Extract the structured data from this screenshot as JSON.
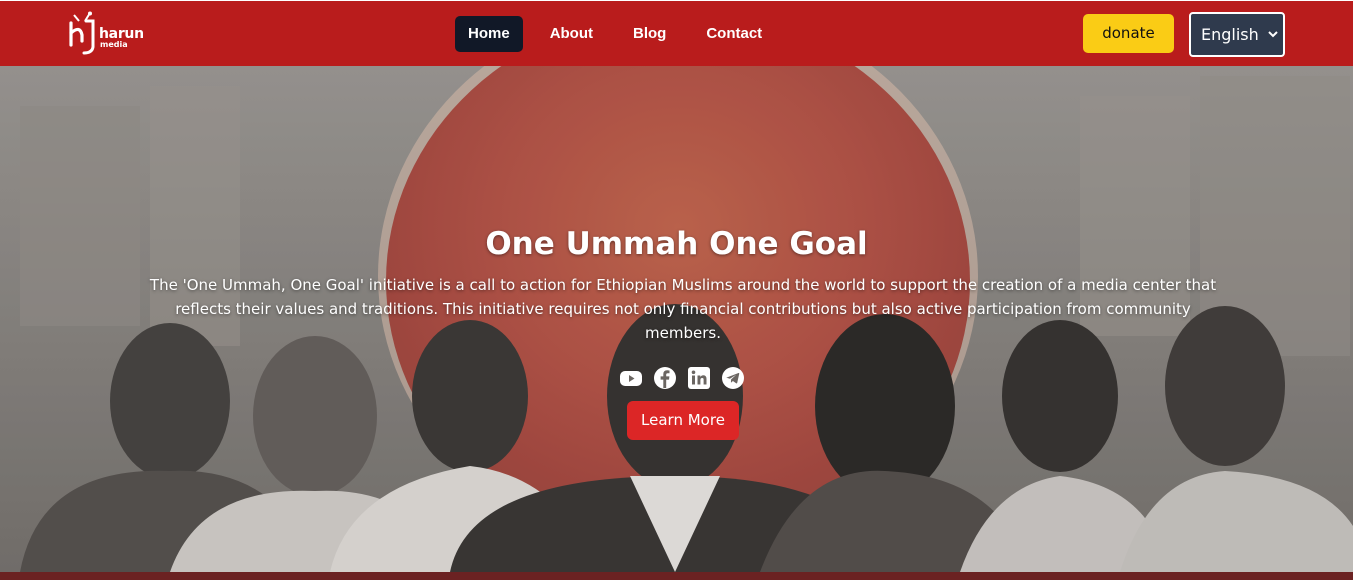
{
  "brand": {
    "name": "harun",
    "sub": "media",
    "colors": {
      "nav": "#b91c1c",
      "donate": "#facc15",
      "cta": "#dc2626",
      "active": "#111827"
    }
  },
  "nav": {
    "items": [
      {
        "label": "Home",
        "active": true
      },
      {
        "label": "About",
        "active": false
      },
      {
        "label": "Blog",
        "active": false
      },
      {
        "label": "Contact",
        "active": false
      }
    ],
    "donate_label": "donate",
    "language": {
      "selected": "English"
    }
  },
  "hero": {
    "title": "One Ummah One Goal",
    "description": "The 'One Ummah, One Goal' initiative is a call to action for Ethiopian Muslims around the world to support the creation of a media center that reflects their values and traditions. This initiative requires not only financial contributions but also active participation from community members.",
    "social_icons": [
      "youtube-icon",
      "facebook-icon",
      "linkedin-icon",
      "telegram-icon"
    ],
    "cta_label": "Learn More"
  }
}
